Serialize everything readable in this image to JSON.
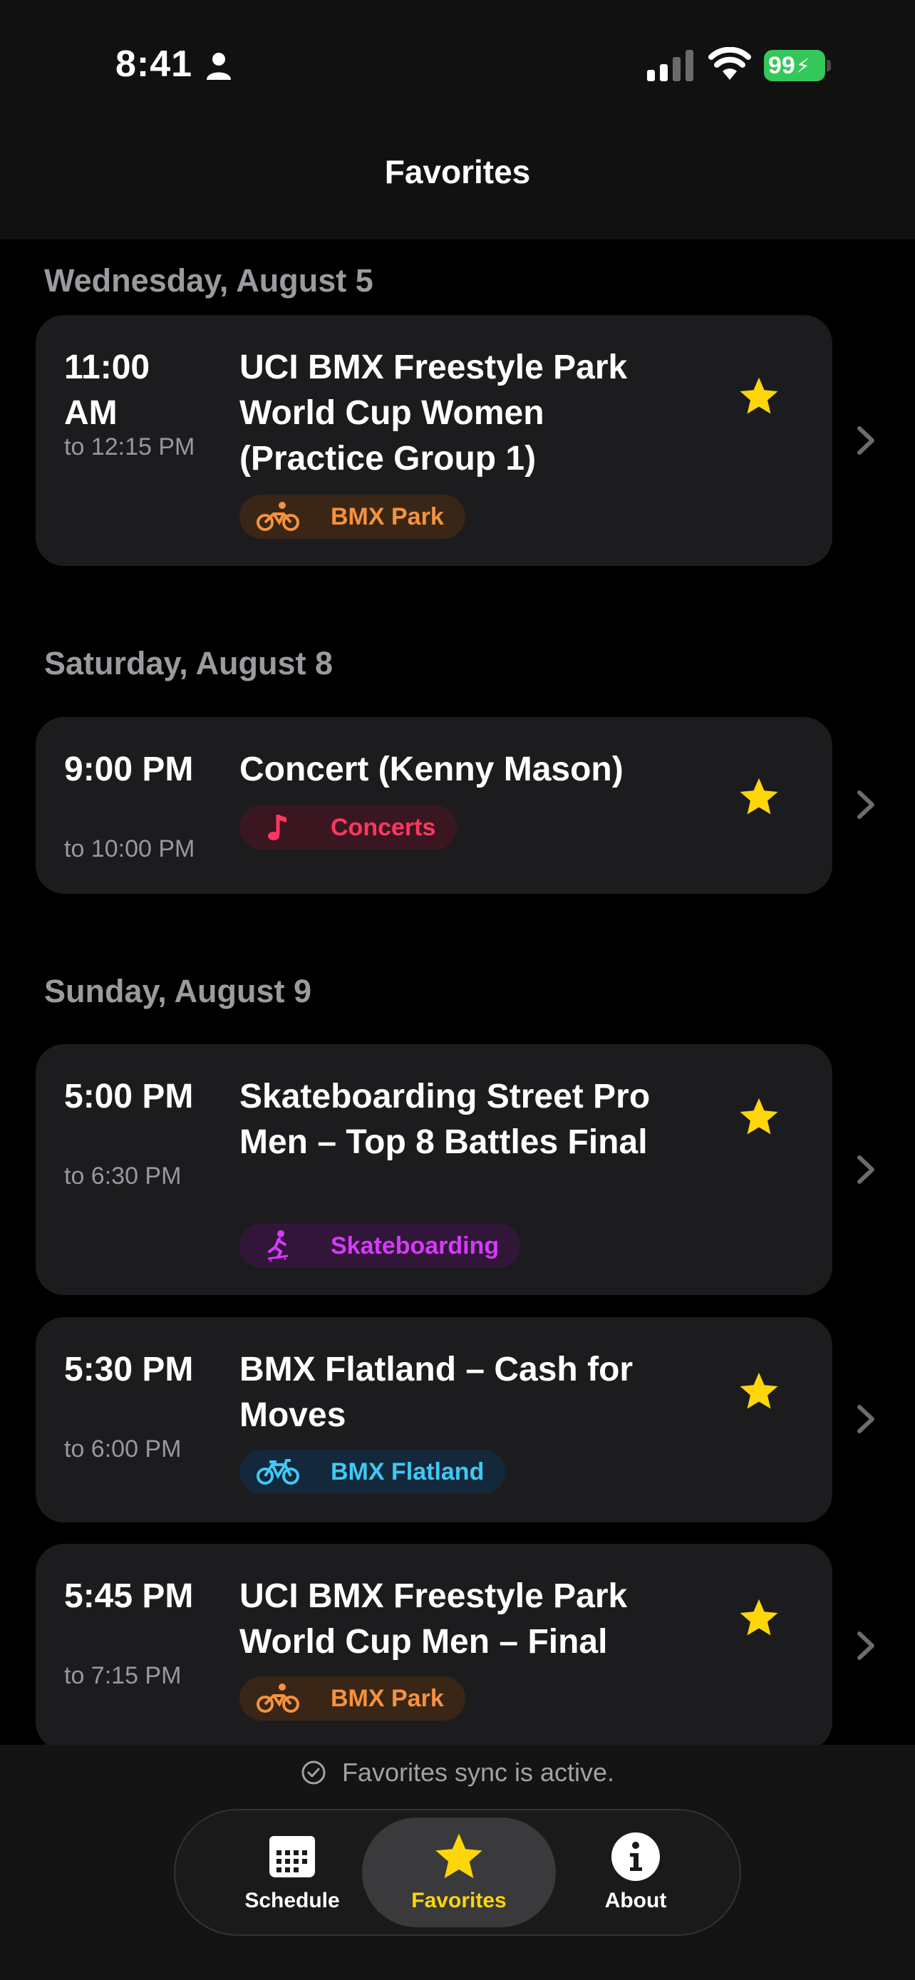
{
  "status_bar": {
    "time": "8:41",
    "battery": "99"
  },
  "header": {
    "title": "Favorites"
  },
  "sections": [
    {
      "date": "Wednesday, August 5",
      "events": [
        {
          "start": "11:00 AM",
          "end": "to 12:15 PM",
          "title": "UCI BMX Freestyle Park World Cup Women (Practice Group 1)",
          "tag": "BMX Park",
          "tag_icon": "bmx-bike-icon"
        }
      ]
    },
    {
      "date": "Saturday, August 8",
      "events": [
        {
          "start": "9:00 PM",
          "end": "to 10:00 PM",
          "title": "Concert (Kenny Mason)",
          "tag": "Concerts",
          "tag_icon": "music-note-icon"
        }
      ]
    },
    {
      "date": "Sunday, August 9",
      "events": [
        {
          "start": "5:00 PM",
          "end": "to 6:30 PM",
          "title": "Skateboarding Street Pro Men – Top 8 Battles Final",
          "tag": "Skateboarding",
          "tag_icon": "skateboarder-icon"
        },
        {
          "start": "5:30 PM",
          "end": "to 6:00 PM",
          "title": "BMX Flatland – Cash for Moves",
          "tag": "BMX Flatland",
          "tag_icon": "bicycle-icon"
        },
        {
          "start": "5:45 PM",
          "end": "to 7:15 PM",
          "title": "UCI BMX Freestyle Park World Cup Men – Final",
          "tag": "BMX Park",
          "tag_icon": "bmx-bike-icon"
        }
      ]
    }
  ],
  "sync_message": "Favorites sync is active.",
  "tabs": [
    {
      "label": "Schedule",
      "icon": "calendar-icon",
      "active": false
    },
    {
      "label": "Favorites",
      "icon": "star-icon",
      "active": true
    },
    {
      "label": "About",
      "icon": "info-icon",
      "active": false
    }
  ],
  "colors": {
    "star": "#ffd60a",
    "bmx_park": "#f5923e",
    "concerts": "#ff375f",
    "skateboarding": "#d63af9",
    "bmx_flatland": "#40c8f4"
  }
}
